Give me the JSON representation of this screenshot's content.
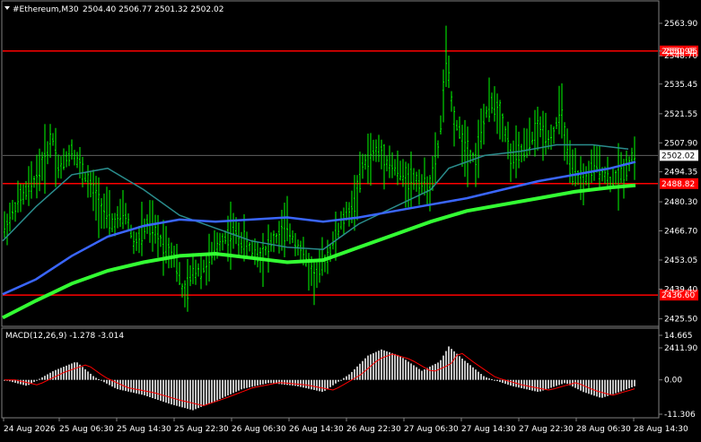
{
  "header": {
    "symbol": "#Ethereum,M30",
    "ohlc": "2504.40 2506.77 2501.32 2502.02"
  },
  "price_axis": {
    "ticks": [
      "2563.90",
      "2550.95",
      "2548.70",
      "2535.45",
      "2521.55",
      "2507.90",
      "2494.35",
      "2480.30",
      "2466.70",
      "2453.05",
      "2439.40",
      "2425.50",
      "2411.90"
    ],
    "current_price": "2502.02",
    "levels": [
      {
        "label": "2550.95",
        "color": "#ff0000"
      },
      {
        "label": "2488.82",
        "color": "#ff0000"
      },
      {
        "label": "2436.60",
        "color": "#ff0000"
      }
    ]
  },
  "macd": {
    "title": "MACD(12,26,9) -1.278 -3.014",
    "ticks": [
      "14.665",
      "0.00",
      "-11.306"
    ]
  },
  "time_axis": {
    "labels": [
      "24 Aug 2026",
      "25 Aug 06:30",
      "25 Aug 14:30",
      "25 Aug 22:30",
      "26 Aug 06:30",
      "26 Aug 14:30",
      "26 Aug 22:30",
      "27 Aug 06:30",
      "27 Aug 14:30",
      "27 Aug 22:30",
      "28 Aug 06:30",
      "28 Aug 14:30"
    ]
  },
  "colors": {
    "candle": "#00ff00",
    "ma_fast": "#2a8c8c",
    "ma_mid": "#3a66ff",
    "ma_slow": "#33ff33",
    "level": "#ff0000",
    "macd_hist": "#c0c0c0",
    "macd_signal": "#ff0000"
  }
}
